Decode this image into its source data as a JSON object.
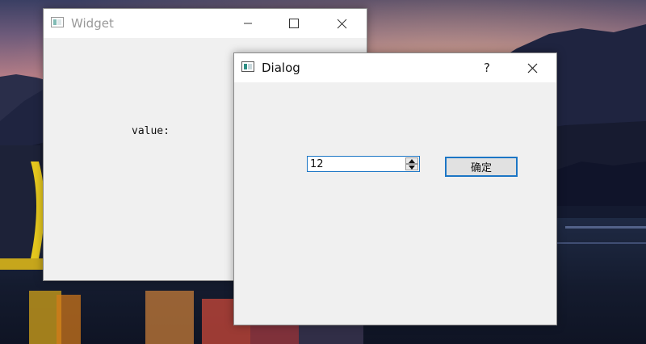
{
  "widget_window": {
    "title": "Widget",
    "value_label": "value:"
  },
  "dialog_window": {
    "title": "Dialog",
    "help_button": "?",
    "spinbox_value": "12",
    "ok_button_label": "确定"
  },
  "colors": {
    "focus_border": "#1c76c5",
    "window_bg": "#f0f0f0",
    "titlebar_bg": "#ffffff"
  }
}
